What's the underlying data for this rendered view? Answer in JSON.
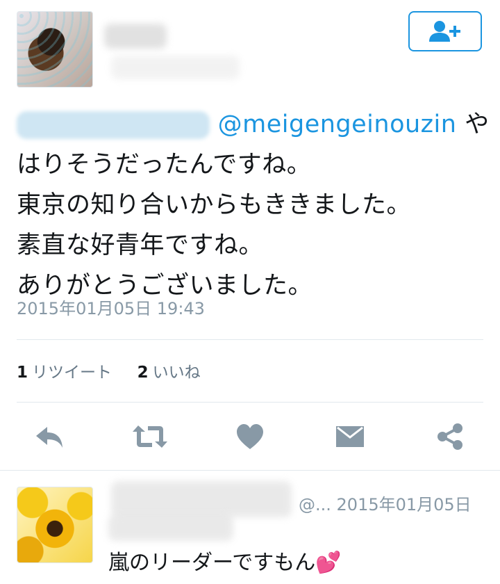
{
  "tweet": {
    "mention": "@meigengeinouzin",
    "text_line1_tail": "や",
    "text_line2": "はりそうだったんですね。",
    "text_line3": "東京の知り合いからもききました。",
    "text_line4": "素直な好青年ですね。",
    "text_line5": "ありがとうございました。",
    "timestamp": "2015年01月05日 19:43"
  },
  "stats": {
    "retweet_count": "1",
    "retweet_label": "リツイート",
    "like_count": "2",
    "like_label": "いいね"
  },
  "actions": [
    "reply-icon",
    "retweet-icon",
    "heart-icon",
    "dm-icon",
    "share-icon"
  ],
  "reply": {
    "handle_truncated": "@...",
    "date": "2015年01月05日",
    "text": "嵐のリーダーですもん💕"
  },
  "colors": {
    "accent": "#1b95e0",
    "icon_gray": "#8899a6",
    "text": "#14171a",
    "muted": "#657786",
    "divider": "#e1e8ed"
  }
}
